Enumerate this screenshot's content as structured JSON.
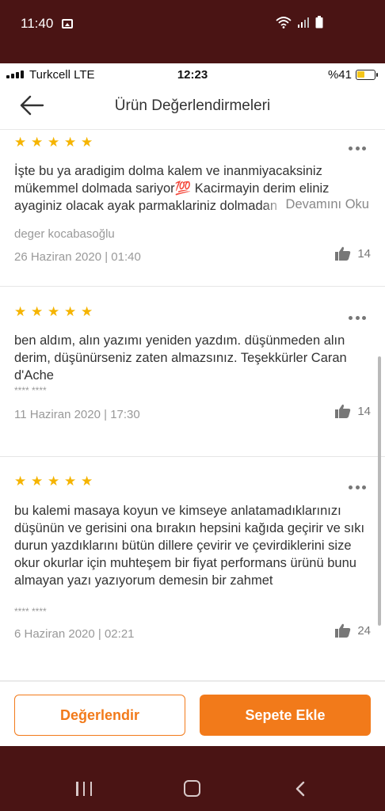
{
  "android_status": {
    "time": "11:40"
  },
  "ios_status": {
    "carrier": "Turkcell  LTE",
    "time": "12:23",
    "battery": "%41"
  },
  "header": {
    "title": "Ürün Değerlendirmeleri"
  },
  "reviews": [
    {
      "rating": 5,
      "text": "İşte bu ya aradigim dolma kalem ve inanmiyacaksiniz mükemmel dolmada sariyor💯 Kacirmayin derim eliniz ayaginiz olacak ayak parmaklariniz dolmadan",
      "read_more": "Devamını Oku",
      "author": "deger kocabasoğlu",
      "date": "26 Haziran 2020 | 01:40",
      "likes": "14"
    },
    {
      "rating": 5,
      "text": "ben aldım, alın yazımı yeniden yazdım.  düşünmeden alın derim, düşünürseniz zaten almazsınız. Teşekkürler Caran d'Ache",
      "author": "**** ****",
      "date": "11 Haziran 2020 | 17:30",
      "likes": "14"
    },
    {
      "rating": 5,
      "text": "bu kalemi masaya koyun ve kimseye anlatamadıklarınızı düşünün ve gerisini ona bırakın hepsini kağıda geçirir ve sıkı durun yazdıklarını bütün dillere çevirir ve çevirdiklerini size okur okurlar için muhteşem bir fiyat performans ürünü bunu almayan yazı yazıyorum demesin bir zahmet",
      "author": "**** ****",
      "date": "6 Haziran 2020 | 02:21",
      "likes": "24"
    }
  ],
  "actions": {
    "rate_label": "Değerlendir",
    "cart_label": "Sepete Ekle"
  },
  "colors": {
    "accent": "#f27a1a",
    "star": "#f5b400",
    "system_bar": "#4a1414"
  },
  "icons": {
    "back": "arrow-left-icon",
    "more": "more-horizontal-icon",
    "like": "thumbs-up-icon",
    "star": "star-icon"
  }
}
